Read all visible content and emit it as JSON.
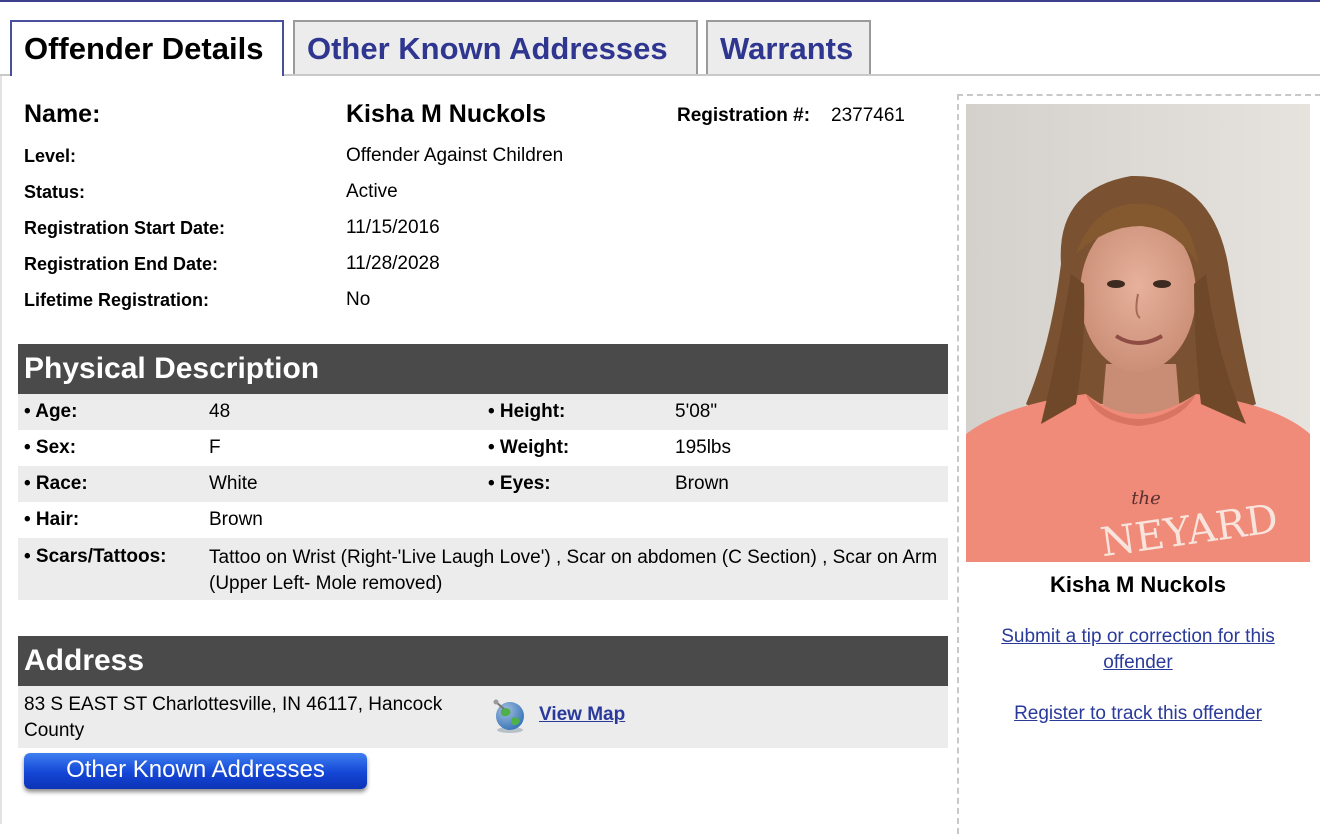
{
  "tabs": [
    {
      "label": "Offender Details",
      "active": true
    },
    {
      "label": "Other Known Addresses",
      "active": false
    },
    {
      "label": "Warrants",
      "active": false
    }
  ],
  "offender": {
    "name_label": "Name:",
    "name": "Kisha M Nuckols",
    "registration_label": "Registration #:",
    "registration_number": "2377461",
    "fields": [
      {
        "label": "Level:",
        "value": "Offender Against Children"
      },
      {
        "label": "Status:",
        "value": "Active"
      },
      {
        "label": "Registration Start Date:",
        "value": "11/15/2016"
      },
      {
        "label": "Registration End Date:",
        "value": "11/28/2028"
      },
      {
        "label": "Lifetime Registration:",
        "value": "No"
      }
    ]
  },
  "physical": {
    "title": "Physical Description",
    "rows": [
      {
        "l1": "• Age:",
        "v1": "48",
        "l2": "• Height:",
        "v2": "5'08\""
      },
      {
        "l1": "• Sex:",
        "v1": "F",
        "l2": "• Weight:",
        "v2": "195lbs"
      },
      {
        "l1": "• Race:",
        "v1": "White",
        "l2": "• Eyes:",
        "v2": "Brown"
      },
      {
        "l1": "• Hair:",
        "v1": "Brown",
        "l2": "",
        "v2": ""
      }
    ],
    "scars_label": "• Scars/Tattoos:",
    "scars_value": "Tattoo on Wrist (Right-'Live Laugh Love') , Scar on abdomen (C Section) , Scar on Arm (Upper Left- Mole removed)"
  },
  "address": {
    "title": "Address",
    "text": "83 S EAST ST Charlottesville, IN 46117, Hancock County",
    "map_link": "View Map",
    "map_icon": "globe-icon",
    "other_button": "Other Known Addresses"
  },
  "sidebar": {
    "name": "Kisha M Nuckols",
    "tip_link": "Submit a tip or correction for this offender",
    "track_link": "Register to track this offender",
    "shirt_text_1": "the",
    "shirt_text_2": "NEYARD"
  },
  "colors": {
    "header_bg": "#4a4a4a",
    "link": "#2a3a9b",
    "tab_text": "#2f3690",
    "button_blue": "#1446d6"
  }
}
